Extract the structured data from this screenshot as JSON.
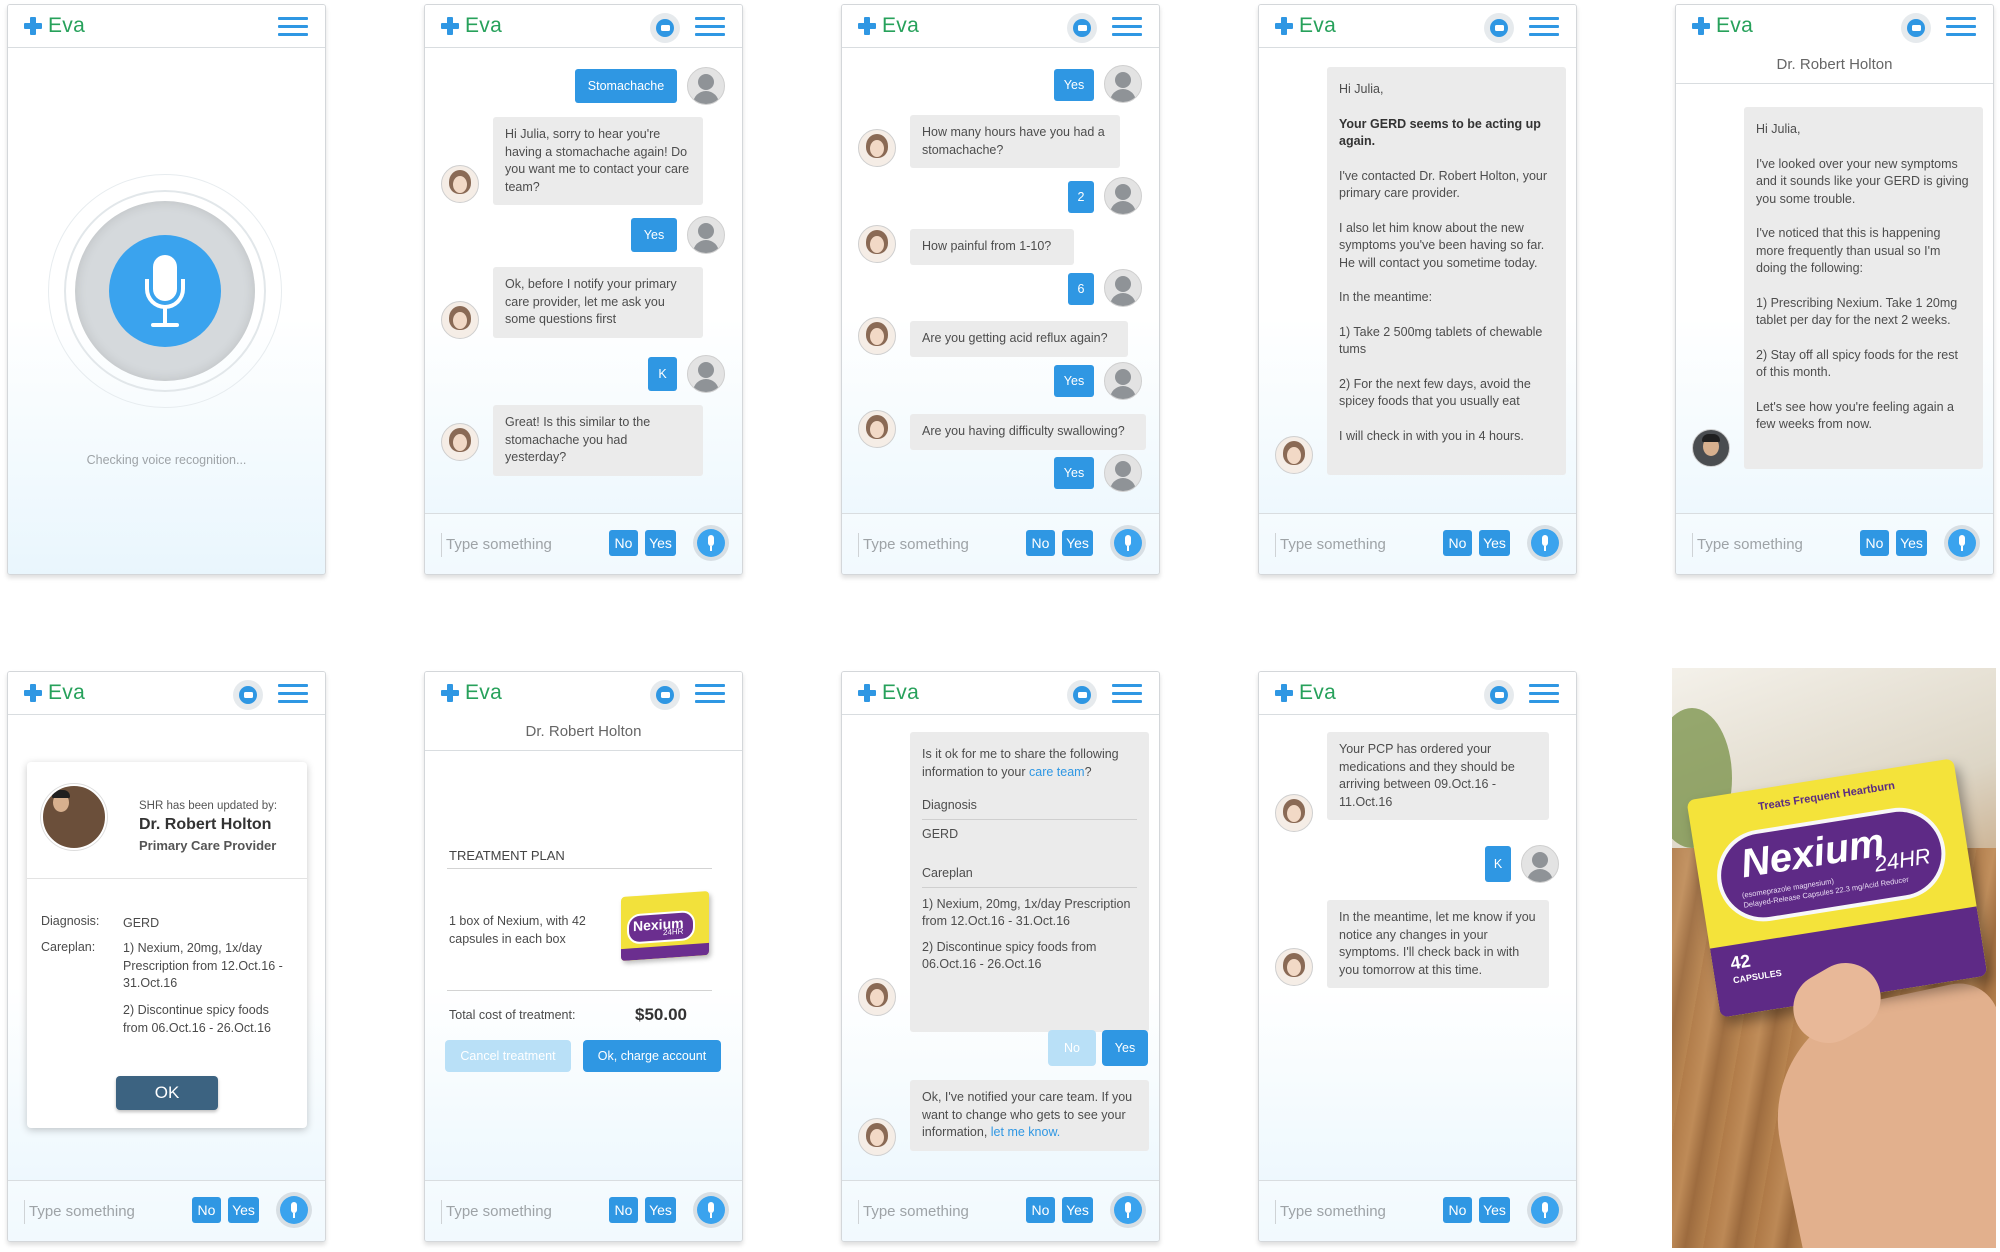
{
  "app": {
    "brand": "Eva",
    "placeholder": "Type something",
    "no": "No",
    "yes": "Yes"
  },
  "s1": {
    "status": "Checking voice recognition..."
  },
  "s2": {
    "u1": "Stomachache",
    "b1": "Hi Julia, sorry to hear you're having a stomachache again! Do you want me to contact your care team?",
    "u2": "Yes",
    "b2": "Ok, before I notify your primary care provider, let me ask you some questions first",
    "u3": "K",
    "b3": "Great! Is this similar to the stomachache you had yesterday?"
  },
  "s3": {
    "u1": "Yes",
    "b1": "How many hours have you had a stomachache?",
    "u2": "2",
    "b2": "How painful from 1-10?",
    "u3": "6",
    "b3": "Are you getting acid reflux again?",
    "u4": "Yes",
    "b4": "Are you having difficulty swallowing?",
    "u5": "Yes"
  },
  "s4": {
    "greet": "Hi Julia,",
    "bold": "Your GERD seems to be acting up again.",
    "p1": "I've contacted Dr. Robert Holton, your primary care provider.",
    "p2": "I also let him know about the new symptoms you've been having so far. He will contact you sometime today.",
    "p3": "In the meantime:",
    "p4": "1) Take 2 500mg tablets of chewable tums",
    "p5": "2) For the next few days, avoid the spicey foods that you usually eat",
    "p6": "I will check in with you in 4 hours."
  },
  "s5": {
    "header": "Dr. Robert Holton",
    "greet": "Hi Julia,",
    "p1": "I've looked over your new symptoms and it sounds like your GERD is giving you some trouble.",
    "p2": "I've noticed that this is happening more frequently than usual so I'm doing the following:",
    "p3": "1) Prescribing Nexium. Take 1 20mg tablet per day for the next 2 weeks.",
    "p4": "2) Stay off all spicy foods for the rest of this month.",
    "p5": "Let's see how you're feeling again a few weeks from now."
  },
  "s6": {
    "updated": "SHR has been updated by:",
    "name": "Dr. Robert Holton",
    "role": "Primary Care Provider",
    "diag_label": "Diagnosis:",
    "diag_value": "GERD",
    "care_label": "Careplan:",
    "care1": "1) Nexium, 20mg, 1x/day Prescription from 12.Oct.16 - 31.Oct.16",
    "care2": "2) Discontinue spicy foods from 06.Oct.16 - 26.Oct.16",
    "ok": "OK"
  },
  "s7": {
    "header": "Dr. Robert Holton",
    "plan_title": "TREATMENT PLAN",
    "item": "1 box of Nexium, with 42 capsules in each box",
    "pack_brand": "Nexium",
    "pack_sub": "24HR",
    "total_label": "Total cost of treatment:",
    "total_value": "$50.00",
    "cancel": "Cancel treatment",
    "charge": "Ok, charge account"
  },
  "s8": {
    "q_pre": "Is it ok for me to share the following information to your ",
    "q_link": "care team",
    "q_post": "?",
    "diag_label": "Diagnosis",
    "diag_value": "GERD",
    "care_label": "Careplan",
    "care1": "1) Nexium, 20mg, 1x/day Prescription from 12.Oct.16 - 31.Oct.16",
    "care2": "2) Discontinue spicy foods from 06.Oct.16 - 26.Oct.16",
    "no": "No",
    "yes": "Yes",
    "reply_pre": "Ok, I've notified your care team. If you want to change who gets to see your information, ",
    "reply_link": "let me know."
  },
  "s9": {
    "b1": "Your PCP has ordered your medications and they should be arriving between 09.Oct.16 - 11.Oct.16",
    "u1": "K",
    "b2": "In the meantime, let me know if you notice any changes in your symptoms. I'll check back in with you tomorrow at this time."
  },
  "photo": {
    "banner": "Treats Frequent Heartburn",
    "brand": "Nexium",
    "sub": "24HR",
    "generic": "(esomeprazole magnesium)",
    "detail": "Delayed-Release Capsules 22.3 mg/Acid Reducer",
    "count": "42",
    "count_label": "CAPSULES"
  },
  "colors": {
    "accent": "#2f97e3",
    "brand_green": "#27a15b",
    "bubble": "#ebebeb"
  }
}
